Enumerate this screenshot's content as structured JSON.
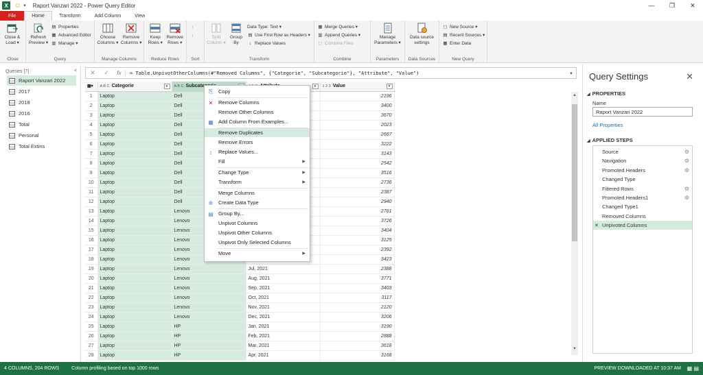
{
  "window": {
    "title": "Raport Vanzari 2022 - Power Query Editor",
    "app_icon": "X",
    "controls": [
      "—",
      "❐",
      "✕"
    ]
  },
  "tabs": [
    "File",
    "Home",
    "Transform",
    "Add Column",
    "View"
  ],
  "ribbon": {
    "close": {
      "label": "Close &\nLoad ▾",
      "group": "Close"
    },
    "query": {
      "refresh": "Refresh\nPreview ▾",
      "properties": "Properties",
      "advanced_editor": "Advanced Editor",
      "manage": "Manage ▾",
      "group": "Query"
    },
    "manage_columns": {
      "choose": "Choose\nColumns ▾",
      "remove": "Remove\nColumns ▾",
      "group": "Manage Columns"
    },
    "reduce_rows": {
      "keep": "Keep\nRows ▾",
      "remove": "Remove\nRows ▾",
      "group": "Reduce Rows"
    },
    "sort": {
      "group": "Sort"
    },
    "transform": {
      "split": "Split\nColumn ▾",
      "groupby": "Group\nBy",
      "data_type": "Data Type: Text ▾",
      "first_row": "Use First Row as Headers ▾",
      "replace": "Replace Values",
      "group": "Transform"
    },
    "combine": {
      "merge": "Merge Queries ▾",
      "append": "Append Queries ▾",
      "files": "Combine Files",
      "group": "Combine"
    },
    "parameters": {
      "manage": "Manage\nParameters ▾",
      "group": "Parameters"
    },
    "data_sources": {
      "settings": "Data source\nsettings",
      "group": "Data Sources"
    },
    "new_query": {
      "new_source": "New Source ▾",
      "recent": "Recent Sources ▾",
      "enter": "Enter Data",
      "group": "New Query"
    }
  },
  "queries": {
    "header": "Queries [7]",
    "collapse": "<",
    "items": [
      "Raport Vanzari 2022",
      "2017",
      "2018",
      "2016",
      "Total",
      "Personal",
      "Total Extins"
    ]
  },
  "formula": {
    "text": "= Table.UnpivotOtherColumns(#\"Removed Columns\", {\"Categorie\", \"Subcategorie\"}, \"Attribute\", \"Value\")",
    "cancel": "✕",
    "commit": "✓",
    "fx": "fx",
    "expand": "▾"
  },
  "grid": {
    "columns": [
      {
        "type": "A B C",
        "name": "Categorie"
      },
      {
        "type": "A B C",
        "name": "Subcategorie"
      },
      {
        "type": "A B C",
        "name": "Attribute"
      },
      {
        "type": "1 2 3",
        "name": "Value"
      }
    ],
    "rows": [
      [
        "1",
        "Laptop",
        "Dell",
        "",
        "2196"
      ],
      [
        "2",
        "Laptop",
        "Dell",
        "",
        "3400"
      ],
      [
        "3",
        "Laptop",
        "Dell",
        "",
        "3670"
      ],
      [
        "4",
        "Laptop",
        "Dell",
        "",
        "2023"
      ],
      [
        "5",
        "Laptop",
        "Dell",
        "",
        "2667"
      ],
      [
        "6",
        "Laptop",
        "Dell",
        "",
        "3222"
      ],
      [
        "7",
        "Laptop",
        "Dell",
        "",
        "3143"
      ],
      [
        "8",
        "Laptop",
        "Dell",
        "",
        "2542"
      ],
      [
        "9",
        "Laptop",
        "Dell",
        "",
        "3516"
      ],
      [
        "10",
        "Laptop",
        "Dell",
        "",
        "2736"
      ],
      [
        "11",
        "Laptop",
        "Dell",
        "",
        "2387"
      ],
      [
        "12",
        "Laptop",
        "Dell",
        "",
        "2940"
      ],
      [
        "13",
        "Laptop",
        "Lenovo",
        "",
        "2761"
      ],
      [
        "14",
        "Laptop",
        "Lenovo",
        "",
        "3726"
      ],
      [
        "15",
        "Laptop",
        "Lenovo",
        "",
        "3404"
      ],
      [
        "16",
        "Laptop",
        "Lenovo",
        "",
        "3125"
      ],
      [
        "17",
        "Laptop",
        "Lenovo",
        "",
        "2392"
      ],
      [
        "18",
        "Laptop",
        "Lenovo",
        "Jun, 2021",
        "3423"
      ],
      [
        "19",
        "Laptop",
        "Lenovo",
        "Jul, 2021",
        "2388"
      ],
      [
        "20",
        "Laptop",
        "Lenovo",
        "Aug, 2021",
        "3771"
      ],
      [
        "21",
        "Laptop",
        "Lenovo",
        "Sep, 2021",
        "3403"
      ],
      [
        "22",
        "Laptop",
        "Lenovo",
        "Oct, 2021",
        "3117"
      ],
      [
        "23",
        "Laptop",
        "Lenovo",
        "Nov, 2021",
        "2120"
      ],
      [
        "24",
        "Laptop",
        "Lenovo",
        "Dec, 2021",
        "3206"
      ],
      [
        "25",
        "Laptop",
        "HP",
        "Jan, 2021",
        "3190"
      ],
      [
        "26",
        "Laptop",
        "HP",
        "Feb, 2021",
        "2888"
      ],
      [
        "27",
        "Laptop",
        "HP",
        "Mar, 2021",
        "3618"
      ],
      [
        "28",
        "Laptop",
        "HP",
        "Apr, 2021",
        "3168"
      ]
    ]
  },
  "context_menu": {
    "items": [
      {
        "label": "Copy",
        "icon": "copy-icon",
        "glyph": "⎘"
      },
      {
        "sep": true
      },
      {
        "label": "Remove Columns",
        "icon": "remove-columns-icon",
        "glyph": "✕"
      },
      {
        "label": "Remove Other Columns"
      },
      {
        "label": "Add Column From Examples...",
        "icon": "add-column-icon",
        "glyph": "▦"
      },
      {
        "sep": true
      },
      {
        "label": "Remove Duplicates",
        "highlight": true
      },
      {
        "label": "Remove Errors"
      },
      {
        "label": "Replace Values...",
        "icon": "replace-icon",
        "glyph": "↕"
      },
      {
        "label": "Fill",
        "sub": true
      },
      {
        "sep": true
      },
      {
        "label": "Change Type",
        "sub": true
      },
      {
        "label": "Transform",
        "sub": true
      },
      {
        "sep": true
      },
      {
        "label": "Merge Columns"
      },
      {
        "label": "Create Data Type",
        "icon": "data-type-icon",
        "glyph": "✲"
      },
      {
        "sep": true
      },
      {
        "label": "Group By...",
        "icon": "group-icon",
        "glyph": "▤"
      },
      {
        "label": "Unpivot Columns"
      },
      {
        "label": "Unpivot Other Columns"
      },
      {
        "label": "Unpivot Only Selected Columns"
      },
      {
        "sep": true
      },
      {
        "label": "Move",
        "sub": true
      }
    ]
  },
  "settings": {
    "title": "Query Settings",
    "close": "✕",
    "properties_header": "PROPERTIES",
    "name_label": "Name",
    "name_value": "Raport Vanzari 2022",
    "all_properties": "All Properties",
    "steps_header": "APPLIED STEPS",
    "steps": [
      {
        "label": "Source",
        "gear": true
      },
      {
        "label": "Navigation",
        "gear": true
      },
      {
        "label": "Promoted Headers",
        "gear": true
      },
      {
        "label": "Changed Type",
        "gear": false
      },
      {
        "label": "Filtered Rows",
        "gear": true
      },
      {
        "label": "Promoted Headers1",
        "gear": true
      },
      {
        "label": "Changed Type1",
        "gear": false
      },
      {
        "label": "Removed Columns",
        "gear": false
      },
      {
        "label": "Unpivoted Columns",
        "gear": false,
        "selected": true
      }
    ]
  },
  "status": {
    "left": "4 COLUMNS, 204 ROWS",
    "middle": "Column profiling based on top 1000 rows",
    "right": "PREVIEW DOWNLOADED AT 10:37 AM"
  },
  "colors": {
    "accent": "#1e7145",
    "selection": "#d6ebe0",
    "file_tab": "#d9201d"
  }
}
